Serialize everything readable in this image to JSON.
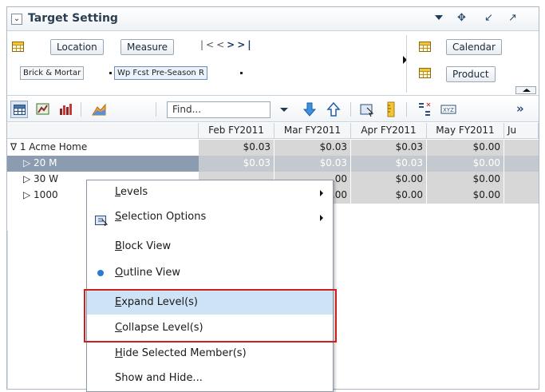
{
  "header": {
    "collapse_icon": "collapse-icon",
    "title": "Target Setting",
    "icons": [
      "dropdown-icon",
      "move-icon",
      "shrink-icon",
      "expand-icon"
    ]
  },
  "pivot": {
    "row_tiles": [
      "Location",
      "Measure"
    ],
    "row_chips": [
      "Brick & Mortar",
      "Wp Fcst Pre-Season R"
    ],
    "col_tiles": [
      "Calendar",
      "Product"
    ]
  },
  "toolbar": {
    "find_placeholder": "Find...",
    "more": "»"
  },
  "table": {
    "columns": [
      "Feb FY2011",
      "Mar FY2011",
      "Apr FY2011",
      "May FY2011",
      "Ju"
    ],
    "rows": [
      {
        "label": "∇ 1 Acme Home",
        "values": [
          "$0.03",
          "$0.03",
          "$0.03",
          "$0.00"
        ]
      },
      {
        "label": "▷ 20 M",
        "values": [
          "$0.03",
          "$0.03",
          "$0.03",
          "$0.00"
        ]
      },
      {
        "label": "▷ 30 W",
        "values": [
          "",
          ".00",
          "$0.00",
          "$0.00"
        ]
      },
      {
        "label": "▷ 1000",
        "values": [
          "",
          ".00",
          "$0.00",
          "$0.00"
        ]
      }
    ]
  },
  "context_menu": {
    "items": [
      {
        "pre": "",
        "key": "L",
        "post": "evels",
        "submenu": true
      },
      {
        "pre": "",
        "key": "S",
        "post": "election Options",
        "submenu": true
      },
      {
        "pre": "",
        "key": "B",
        "post": "lock View",
        "submenu": false
      },
      {
        "pre": "",
        "key": "O",
        "post": "utline View",
        "submenu": false
      },
      {
        "pre": "",
        "key": "E",
        "post": "xpand Level(s)",
        "submenu": false
      },
      {
        "pre": "",
        "key": "C",
        "post": "ollapse Level(s)",
        "submenu": false
      },
      {
        "pre": "",
        "key": "H",
        "post": "ide Selected Member(s)",
        "submenu": false
      },
      {
        "pre": "Show and Hide...",
        "key": "",
        "post": "",
        "submenu": false
      }
    ]
  },
  "colors": {
    "selected_row": "#8b9bb0",
    "menu_highlight": "#cfe3f6",
    "annotation": "#cc1f1f",
    "header_title": "#2b3f52"
  }
}
